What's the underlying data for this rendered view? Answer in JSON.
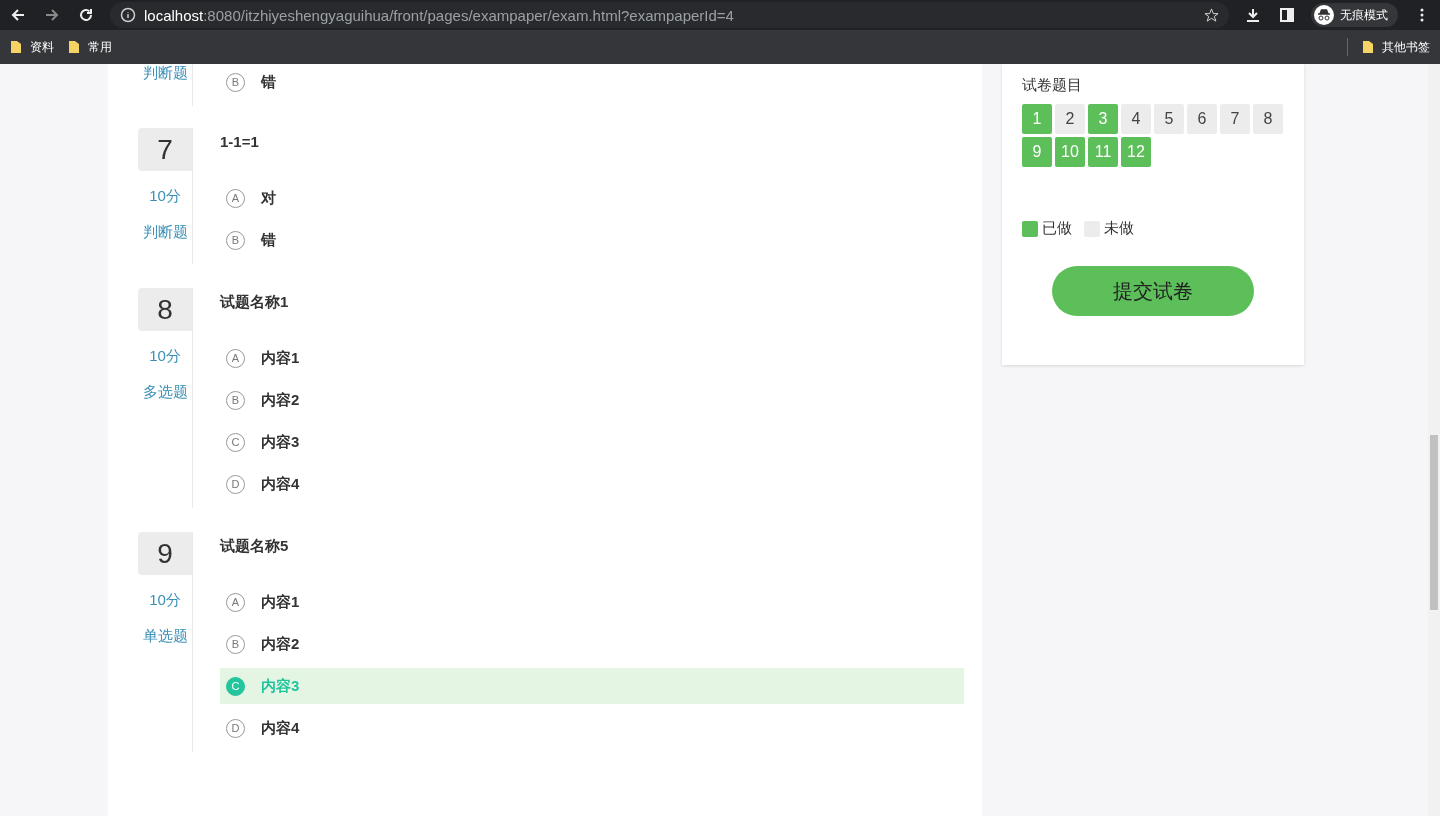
{
  "browser": {
    "url_host": "localhost",
    "url_rest": ":8080/itzhiyeshengyaguihua/front/pages/exampaper/exam.html?exampaperId=4",
    "profile": "无痕模式",
    "bookmarks": [
      "资料",
      "常用"
    ],
    "other_bookmarks": "其他书签"
  },
  "questions": [
    {
      "type": "判断题",
      "options": [
        {
          "letter": "B",
          "text": "错",
          "selected": false
        }
      ]
    },
    {
      "number": "7",
      "score": "10分",
      "type": "判断题",
      "title": "1-1=1",
      "options": [
        {
          "letter": "A",
          "text": "对",
          "selected": false
        },
        {
          "letter": "B",
          "text": "错",
          "selected": false
        }
      ]
    },
    {
      "number": "8",
      "score": "10分",
      "type": "多选题",
      "title": "试题名称1",
      "options": [
        {
          "letter": "A",
          "text": "内容1",
          "selected": false
        },
        {
          "letter": "B",
          "text": "内容2",
          "selected": false
        },
        {
          "letter": "C",
          "text": "内容3",
          "selected": false
        },
        {
          "letter": "D",
          "text": "内容4",
          "selected": false
        }
      ]
    },
    {
      "number": "9",
      "score": "10分",
      "type": "单选题",
      "title": "试题名称5",
      "options": [
        {
          "letter": "A",
          "text": "内容1",
          "selected": false
        },
        {
          "letter": "B",
          "text": "内容2",
          "selected": false
        },
        {
          "letter": "C",
          "text": "内容3",
          "selected": true
        },
        {
          "letter": "D",
          "text": "内容4",
          "selected": false
        }
      ]
    }
  ],
  "sidebar": {
    "title": "试卷题目",
    "items": [
      {
        "label": "1",
        "done": true
      },
      {
        "label": "2",
        "done": false
      },
      {
        "label": "3",
        "done": true
      },
      {
        "label": "4",
        "done": false
      },
      {
        "label": "5",
        "done": false
      },
      {
        "label": "6",
        "done": false
      },
      {
        "label": "7",
        "done": false
      },
      {
        "label": "8",
        "done": false
      },
      {
        "label": "9",
        "done": true
      },
      {
        "label": "10",
        "done": true
      },
      {
        "label": "11",
        "done": true
      },
      {
        "label": "12",
        "done": true
      }
    ],
    "legend": [
      {
        "label": "已做",
        "done": true
      },
      {
        "label": "未做",
        "done": false
      }
    ],
    "submit": "提交试卷"
  }
}
